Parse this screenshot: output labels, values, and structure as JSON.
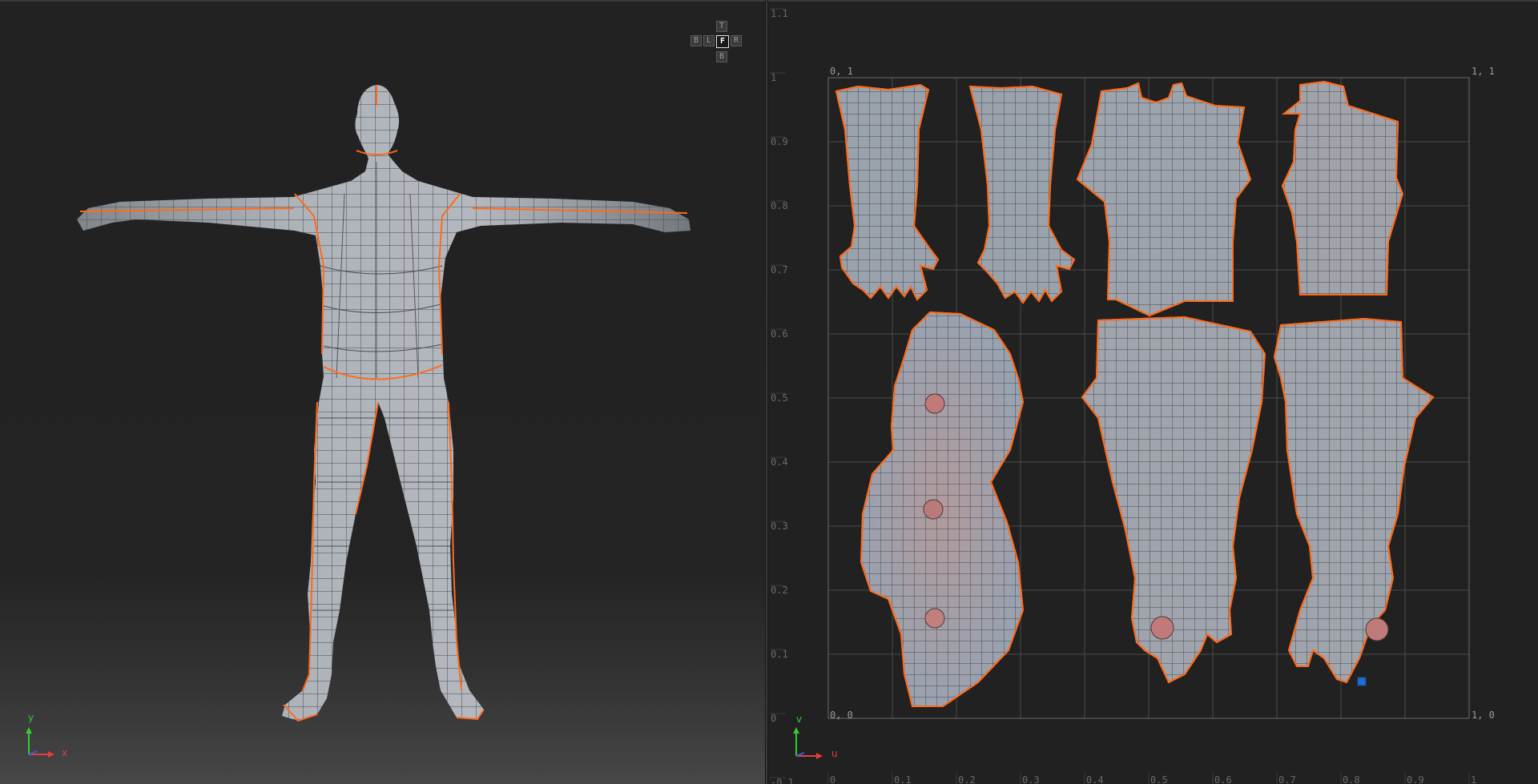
{
  "viewport3d": {
    "view_cube": {
      "top": "T",
      "back": "B",
      "left": "L",
      "front": "F",
      "right": "R",
      "bottom": "B",
      "active": "F"
    },
    "axis": {
      "y": "y",
      "x": "x"
    },
    "colors": {
      "mesh_fill": "#9aa0a8",
      "mesh_edge": "#3c3f44",
      "seam": "#ff6a1a"
    }
  },
  "uv_editor": {
    "v_ticks": [
      "1.1",
      "1",
      "0.9",
      "0.8",
      "0.7",
      "0.6",
      "0.5",
      "0.4",
      "0.3",
      "0.2",
      "0.1",
      "0",
      "-0.1"
    ],
    "u_ticks": [
      "0",
      "0.1",
      "0.2",
      "0.3",
      "0.4",
      "0.5",
      "0.6",
      "0.7",
      "0.8",
      "0.9",
      "1"
    ],
    "corners": {
      "top_left": "0, 1",
      "top_right": "1, 1",
      "bottom_left": "0, 0",
      "bottom_right": "1, 0"
    },
    "axis": {
      "v": "v",
      "u": "u"
    },
    "islands": [
      "arm-left",
      "arm-right",
      "torso-front",
      "torso-back",
      "head",
      "leg-left",
      "leg-right"
    ],
    "colors": {
      "island_fill": "#9ea3ab",
      "island_edge": "#3a3d42",
      "seam": "#ff6a1a",
      "grid": "#4a4a4a",
      "selected_face": "#1f6fd1"
    }
  }
}
